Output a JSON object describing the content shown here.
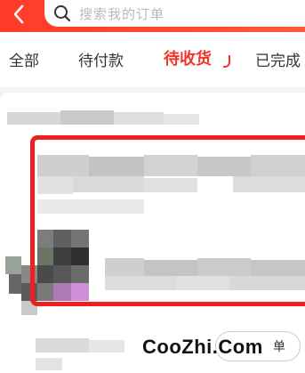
{
  "header": {
    "back_icon": "chevron-left-icon",
    "search_icon": "search-icon",
    "search_placeholder": "搜索我的订单",
    "bg_color": "#ff4a32"
  },
  "tabs": {
    "items": [
      {
        "label": "全部"
      },
      {
        "label": "待付款"
      },
      {
        "label": "待收货"
      },
      {
        "label": "已完成"
      }
    ],
    "active_index": 2,
    "active_color": "#f2352a"
  },
  "order": {
    "action_label": "单"
  },
  "highlight_color": "#f01e1e",
  "watermark": "CooZhi.Com"
}
